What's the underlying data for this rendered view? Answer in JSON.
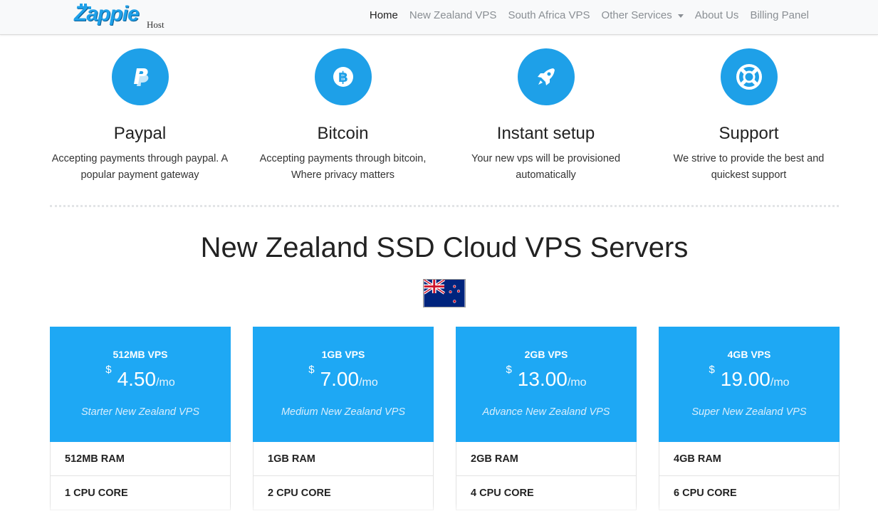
{
  "brand": {
    "name": "Zappie",
    "sub": "Host"
  },
  "nav": {
    "items": [
      {
        "label": "Home"
      },
      {
        "label": "New Zealand VPS"
      },
      {
        "label": "South Africa VPS"
      },
      {
        "label": "Other Services"
      },
      {
        "label": "About Us"
      },
      {
        "label": "Billing Panel"
      }
    ]
  },
  "features": [
    {
      "icon": "paypal-icon",
      "title": "Paypal",
      "line1": "Accepting payments through paypal. A",
      "line2": "popular payment gateway"
    },
    {
      "icon": "bitcoin-icon",
      "title": "Bitcoin",
      "line1": "Accepting payments through bitcoin,",
      "line2": "Where privacy matters"
    },
    {
      "icon": "rocket-icon",
      "title": "Instant setup",
      "line1": "Your new vps will be provisioned",
      "line2": "automatically"
    },
    {
      "icon": "lifebuoy-icon",
      "title": "Support",
      "line1": "We strive to provide the best and",
      "line2": "quickest support"
    }
  ],
  "section": {
    "title": "New Zealand SSD Cloud VPS Servers",
    "flag": "new-zealand-flag"
  },
  "plans": [
    {
      "name": "512MB VPS",
      "currency": "$",
      "price": "4.50",
      "period": "/mo",
      "subtitle": "Starter New Zealand VPS",
      "features": [
        "512MB RAM",
        "1 CPU CORE"
      ]
    },
    {
      "name": "1GB VPS",
      "currency": "$",
      "price": "7.00",
      "period": "/mo",
      "subtitle": "Medium New Zealand VPS",
      "features": [
        "1GB RAM",
        "2 CPU CORE"
      ]
    },
    {
      "name": "2GB VPS",
      "currency": "$",
      "price": "13.00",
      "period": "/mo",
      "subtitle": "Advance New Zealand VPS",
      "features": [
        "2GB RAM",
        "4 CPU CORE"
      ]
    },
    {
      "name": "4GB VPS",
      "currency": "$",
      "price": "19.00",
      "period": "/mo",
      "subtitle": "Super New Zealand VPS",
      "features": [
        "4GB RAM",
        "6 CPU CORE"
      ]
    }
  ],
  "colors": {
    "accent": "#1ea0e8",
    "card": "#1ea8f4"
  }
}
